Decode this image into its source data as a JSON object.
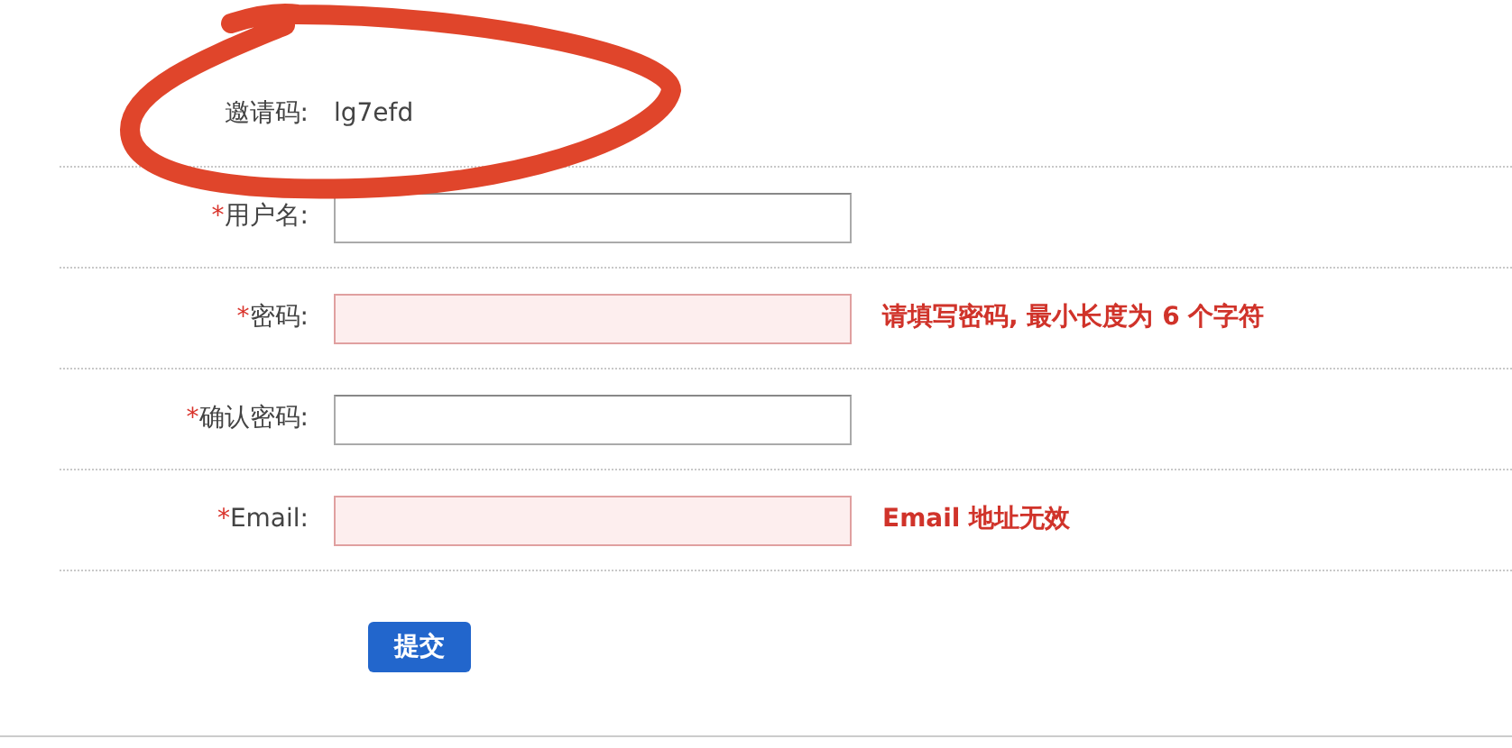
{
  "invite": {
    "label": "邀请码:",
    "value": "lg7efd"
  },
  "fields": [
    {
      "required_mark": "*",
      "label": "用户名:",
      "invalid": false
    },
    {
      "required_mark": "*",
      "label": "密码:",
      "invalid": true,
      "error": "请填写密码, 最小长度为 6 个字符"
    },
    {
      "required_mark": "*",
      "label": "确认密码:",
      "invalid": false
    },
    {
      "required_mark": "*",
      "label": "Email:",
      "invalid": true,
      "error": "Email 地址无效"
    }
  ],
  "submit": "提交"
}
